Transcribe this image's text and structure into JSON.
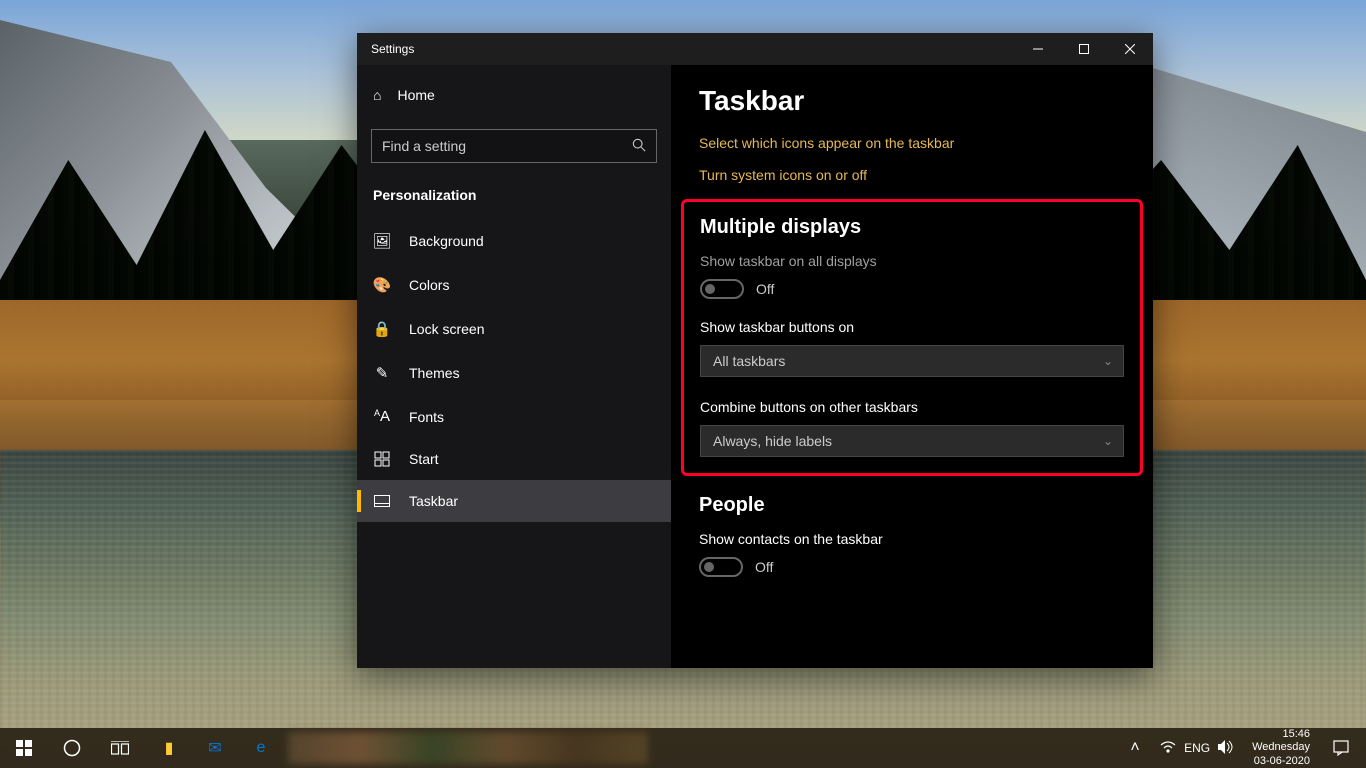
{
  "window": {
    "title": "Settings"
  },
  "sidebar": {
    "home": "Home",
    "search_placeholder": "Find a setting",
    "section": "Personalization",
    "items": [
      {
        "label": "Background",
        "icon": "🖼"
      },
      {
        "label": "Colors",
        "icon": "🎨"
      },
      {
        "label": "Lock screen",
        "icon": "🔒"
      },
      {
        "label": "Themes",
        "icon": "✎"
      },
      {
        "label": "Fonts",
        "icon": "A"
      },
      {
        "label": "Start",
        "icon": "⊞"
      },
      {
        "label": "Taskbar",
        "icon": "▭"
      }
    ],
    "selected": "Taskbar"
  },
  "content": {
    "title": "Taskbar",
    "links": {
      "select_icons": "Select which icons appear on the taskbar",
      "system_icons": "Turn system icons on or off"
    },
    "multiple_displays": {
      "heading": "Multiple displays",
      "show_all_label": "Show taskbar on all displays",
      "show_all_state": "Off",
      "buttons_on_label": "Show taskbar buttons on",
      "buttons_on_value": "All taskbars",
      "combine_label": "Combine buttons on other taskbars",
      "combine_value": "Always, hide labels"
    },
    "people": {
      "heading": "People",
      "show_contacts_label": "Show contacts on the taskbar",
      "show_contacts_state": "Off"
    }
  },
  "taskbar": {
    "lang": "ENG",
    "time": "15:46",
    "day": "Wednesday",
    "date": "03-06-2020"
  }
}
